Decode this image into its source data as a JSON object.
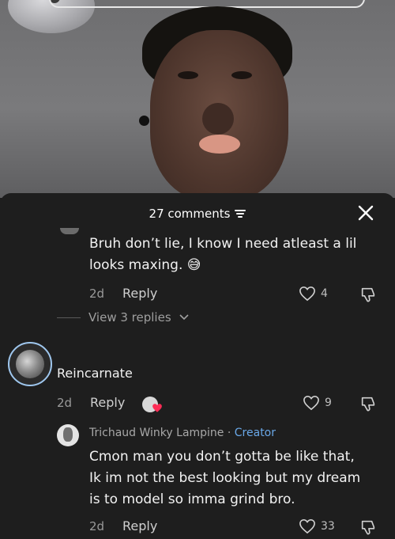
{
  "header": {
    "comment_count": "27 comments"
  },
  "comments": [
    {
      "text_line1": "Bruh don’t lie, I know I need atleast a lil",
      "text_line2": "looks maxing. 😅",
      "age": "2d",
      "reply_label": "Reply",
      "likes": "4"
    },
    {
      "username": "Reincarnate",
      "age": "2d",
      "reply_label": "Reply",
      "likes": "9",
      "view_replies": "View 3 replies"
    },
    {
      "username": "Trichaud Winky Lampine",
      "separator": " · ",
      "badge": "Creator",
      "text_line1": "Cmon man you don’t gotta be like that,",
      "text_line2": "Ik im not the best looking but my dream",
      "text_line3": "is to model so imma grind bro.",
      "age": "2d",
      "reply_label": "Reply",
      "likes": "33"
    }
  ],
  "icons": [
    "filter-icon",
    "close-icon",
    "heart-outline-icon",
    "thumbs-down-icon",
    "chevron-down-icon",
    "creator-liked-heart-icon"
  ],
  "colors": {
    "sheet_bg": "#1e1e1e",
    "creator_badge": "#6aa8e8",
    "liked_heart": "#fe2c55"
  }
}
